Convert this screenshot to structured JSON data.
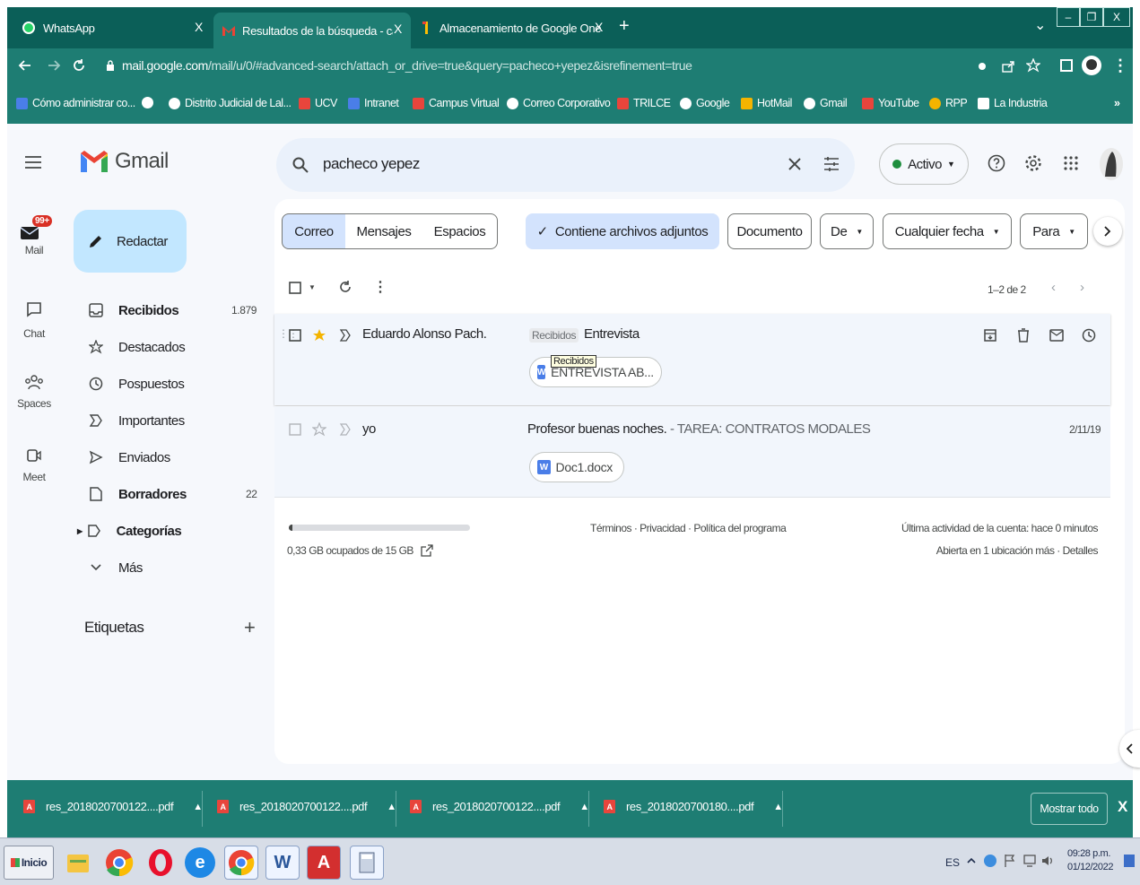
{
  "browser": {
    "tabs": [
      {
        "title": "WhatsApp",
        "close": "X"
      },
      {
        "title": "Resultados de la búsqueda - carme",
        "close": "X"
      },
      {
        "title": "Almacenamiento de Google One",
        "close": "X"
      }
    ],
    "new_tab": "+",
    "tab_list": "⌄",
    "window": {
      "minimize": "–",
      "restore": "❐",
      "close": "X"
    },
    "url_host": "mail.google.com",
    "url_path": "/mail/u/0/#advanced-search/attach_or_drive=true&query=pacheco+yepez&isrefinement=true",
    "bookmarks": [
      {
        "label": "Cómo administrar co...",
        "color": "#4a7ee8"
      },
      {
        "label": "",
        "color": "#ffffff"
      },
      {
        "label": "Distrito Judicial de Lal...",
        "color": "#ffffff"
      },
      {
        "label": "UCV",
        "color": "#e8453c"
      },
      {
        "label": "Intranet",
        "color": "#4a7ee8"
      },
      {
        "label": "Campus Virtual",
        "color": "#e8453c"
      },
      {
        "label": "Correo Corporativo",
        "color": "#ffffff"
      },
      {
        "label": "TRILCE",
        "color": "#e8453c"
      },
      {
        "label": "Google",
        "color": "#ffffff"
      },
      {
        "label": "HotMail",
        "color": "#f4b400"
      },
      {
        "label": "Gmail",
        "color": "#ffffff"
      },
      {
        "label": "YouTube",
        "color": "#e8453c"
      },
      {
        "label": "RPP",
        "color": "#f4b400"
      },
      {
        "label": "La Industria",
        "color": "#ffffff"
      }
    ],
    "bookmarks_more": "»"
  },
  "gmail": {
    "logo_text": "Gmail",
    "search_value": "pacheco yepez",
    "status": "Activo",
    "rail": [
      {
        "label": "Mail",
        "badge": "99+"
      },
      {
        "label": "Chat"
      },
      {
        "label": "Spaces"
      },
      {
        "label": "Meet"
      }
    ],
    "compose": "Redactar",
    "nav": [
      {
        "label": "Recibidos",
        "count": "1.879"
      },
      {
        "label": "Destacados",
        "count": ""
      },
      {
        "label": "Pospuestos",
        "count": ""
      },
      {
        "label": "Importantes",
        "count": ""
      },
      {
        "label": "Enviados",
        "count": ""
      },
      {
        "label": "Borradores",
        "count": "22"
      },
      {
        "label": "Categorías",
        "count": ""
      },
      {
        "label": "Más",
        "count": ""
      }
    ],
    "labels_heading": "Etiquetas",
    "labels_add": "+",
    "filters": {
      "segments": [
        "Correo",
        "Mensajes",
        "Espacios"
      ],
      "has_attachment": "Contiene archivos adjuntos",
      "document": "Documento",
      "from": "De",
      "date": "Cualquier fecha",
      "to": "Para"
    },
    "pagination": "1–2 de 2",
    "messages": [
      {
        "sender": "Eduardo Alonso Pach.",
        "label": "Recibidos",
        "subject": "Entrevista",
        "snippet": "",
        "date": "",
        "attachment": "ENTREVISTA AB...",
        "tooltip": "Recibidos"
      },
      {
        "sender": "yo",
        "label": "",
        "subject": "Profesor buenas noches.",
        "snippet": " - TAREA: CONTRATOS MODALES",
        "date": "2/11/19",
        "attachment": "Doc1.docx",
        "tooltip": ""
      }
    ],
    "storage": {
      "text": "0,33 GB ocupados de 15 GB",
      "fraction": 0.022
    },
    "footer_links": "Términos · Privacidad · Política del programa",
    "last_activity": "Última actividad de la cuenta: hace 0 minutos",
    "open_in": "Abierta en 1 ubicación más · Detalles"
  },
  "downloads": {
    "items": [
      "res_2018020700122....pdf",
      "res_2018020700122....pdf",
      "res_2018020700122....pdf",
      "res_2018020700180....pdf"
    ],
    "show_all": "Mostrar todo",
    "close": "X"
  },
  "taskbar": {
    "start": "Inicio",
    "lang": "ES",
    "time": "09:28 p.m.",
    "date": "01/12/2022"
  }
}
